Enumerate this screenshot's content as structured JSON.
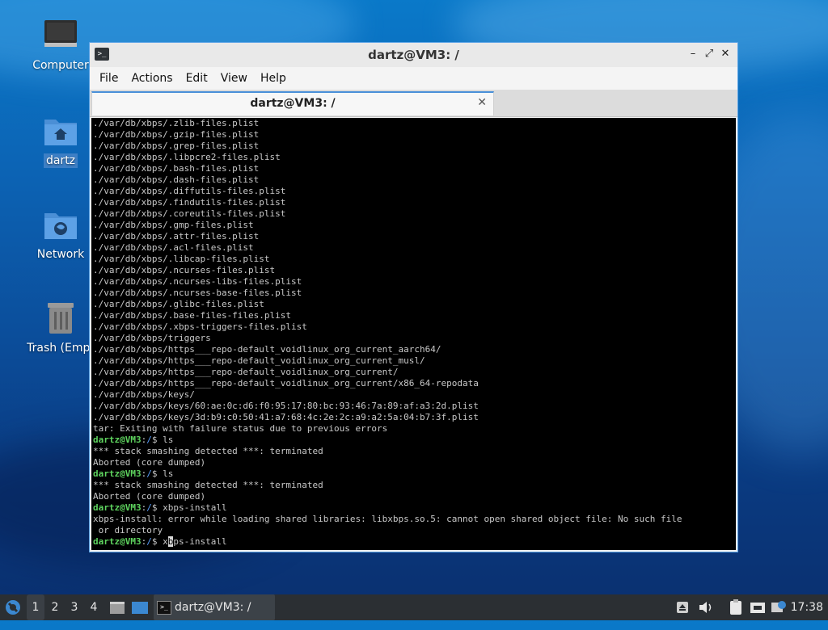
{
  "desktop": {
    "icons": [
      {
        "label": "Computer"
      },
      {
        "label": "dartz"
      },
      {
        "label": "Network"
      },
      {
        "label": "Trash (Empt"
      }
    ]
  },
  "window": {
    "title": "dartz@VM3: /",
    "menu": [
      "File",
      "Actions",
      "Edit",
      "View",
      "Help"
    ],
    "tab_title": "dartz@VM3: /",
    "controls": {
      "minimize": "–",
      "maximize": "⤢",
      "close": "✕"
    }
  },
  "terminal": {
    "prompt": "dartz@VM3",
    "lines": [
      "./var/db/xbps/.zlib-files.plist",
      "./var/db/xbps/.gzip-files.plist",
      "./var/db/xbps/.grep-files.plist",
      "./var/db/xbps/.libpcre2-files.plist",
      "./var/db/xbps/.bash-files.plist",
      "./var/db/xbps/.dash-files.plist",
      "./var/db/xbps/.diffutils-files.plist",
      "./var/db/xbps/.findutils-files.plist",
      "./var/db/xbps/.coreutils-files.plist",
      "./var/db/xbps/.gmp-files.plist",
      "./var/db/xbps/.attr-files.plist",
      "./var/db/xbps/.acl-files.plist",
      "./var/db/xbps/.libcap-files.plist",
      "./var/db/xbps/.ncurses-files.plist",
      "./var/db/xbps/.ncurses-libs-files.plist",
      "./var/db/xbps/.ncurses-base-files.plist",
      "./var/db/xbps/.glibc-files.plist",
      "./var/db/xbps/.base-files-files.plist",
      "./var/db/xbps/.xbps-triggers-files.plist",
      "./var/db/xbps/triggers",
      "./var/db/xbps/https___repo-default_voidlinux_org_current_aarch64/",
      "./var/db/xbps/https___repo-default_voidlinux_org_current_musl/",
      "./var/db/xbps/https___repo-default_voidlinux_org_current/",
      "./var/db/xbps/https___repo-default_voidlinux_org_current/x86_64-repodata",
      "./var/db/xbps/keys/",
      "./var/db/xbps/keys/60:ae:0c:d6:f0:95:17:80:bc:93:46:7a:89:af:a3:2d.plist",
      "./var/db/xbps/keys/3d:b9:c0:50:41:a7:68:4c:2e:2c:a9:a2:5a:04:b7:3f.plist",
      "tar: Exiting with failure status due to previous errors",
      {
        "cmd": "ls"
      },
      "*** stack smashing detected ***: terminated",
      "Aborted (core dumped)",
      {
        "cmd": "ls"
      },
      "*** stack smashing detected ***: terminated",
      "Aborted (core dumped)",
      {
        "cmd": "xbps-install"
      },
      "xbps-install: error while loading shared libraries: libxbps.so.5: cannot open shared object file: No such file",
      " or directory",
      {
        "cmd": "xbps-install",
        "cursor_index": 1
      }
    ]
  },
  "taskbar": {
    "workspaces": [
      "1",
      "2",
      "3",
      "4"
    ],
    "active_workspace": "1",
    "task_label": "dartz@VM3: /",
    "clock": "17:38"
  }
}
